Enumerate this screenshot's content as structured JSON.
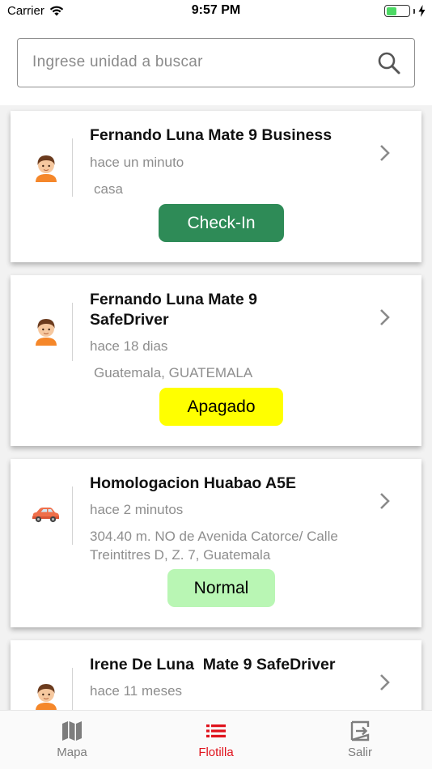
{
  "status_bar": {
    "carrier": "Carrier",
    "time": "9:57 PM",
    "battery_level": 0.45
  },
  "search": {
    "placeholder": "Ingrese unidad a buscar",
    "value": ""
  },
  "units": [
    {
      "title": "Fernando Luna Mate 9 Business",
      "time": "hace un minuto",
      "location": "casa",
      "status": "Check-In",
      "icon": "person-avatar-icon",
      "status_bg": "#2e8b57",
      "status_fg": "#ffffff"
    },
    {
      "title": "Fernando Luna Mate 9 SafeDriver",
      "time": "hace 18 dias",
      "location": "Guatemala, GUATEMALA",
      "status": "Apagado",
      "icon": "person-avatar-icon",
      "status_bg": "#ffff00",
      "status_fg": "#000000"
    },
    {
      "title": "Homologacion Huabao A5E",
      "time": "hace 2 minutos",
      "location": "304.40 m. NO de  Avenida Catorce/ Calle Treintitres D, Z. 7, Guatemala",
      "status": "Normal",
      "icon": "car-icon",
      "status_bg": "#b9f6b4",
      "status_fg": "#000000"
    },
    {
      "title": "Irene De Luna  Mate 9 SafeDriver",
      "time": "hace 11 meses",
      "icon": "person-avatar-icon"
    }
  ],
  "tabs": [
    {
      "label": "Mapa",
      "icon": "map-icon"
    },
    {
      "label": "Flotilla",
      "icon": "list-icon"
    },
    {
      "label": "Salir",
      "icon": "logout-icon"
    }
  ],
  "colors": {
    "accent": "#e0121c",
    "tab_inactive": "#7d7d7d"
  }
}
